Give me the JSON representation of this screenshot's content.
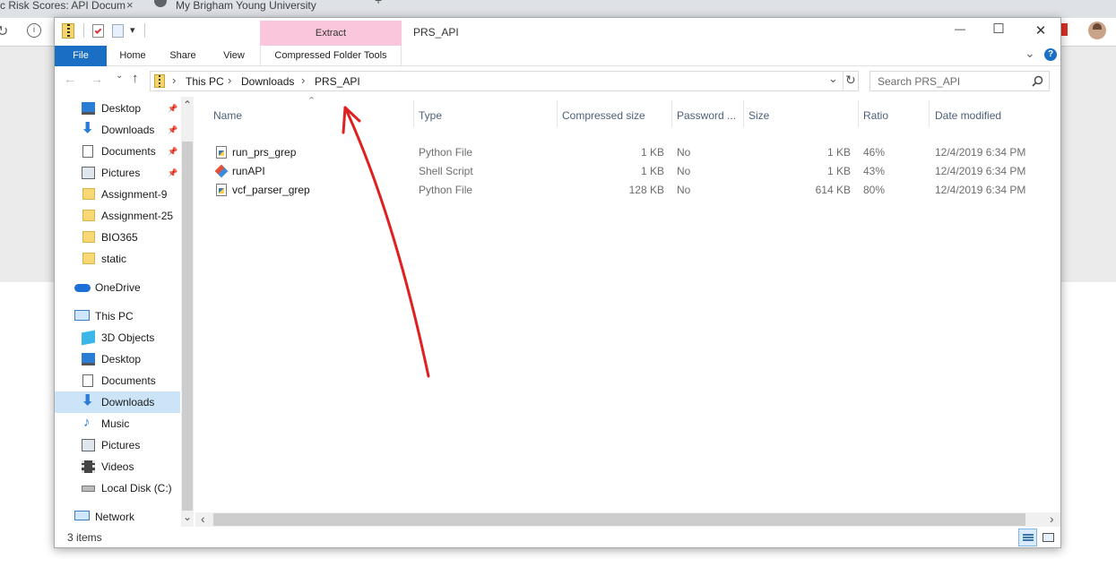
{
  "browser": {
    "tabs": [
      "c Risk Scores: API Docum",
      "My Brigham Young University Ho"
    ],
    "close_glyph": "×",
    "new_tab_glyph": "+"
  },
  "window": {
    "title": "PRS_API",
    "qat_dropdown": "▾",
    "minimize": "—",
    "maximize": "☐",
    "close": "✕"
  },
  "ribbon": {
    "contextual_group": "Extract",
    "tabs": {
      "file": "File",
      "home": "Home",
      "share": "Share",
      "view": "View",
      "compressed": "Compressed Folder Tools"
    },
    "expand_glyph": "⌄",
    "help_glyph": "?"
  },
  "address": {
    "sep": "›",
    "path": [
      "This PC",
      "Downloads",
      "PRS_API"
    ],
    "dropdown": "⌄",
    "refresh": "↻",
    "search_placeholder": "Search PRS_API",
    "back": "←",
    "forward": "→",
    "up": "↑"
  },
  "nav": {
    "quick_access": [
      {
        "label": "Desktop",
        "pinned": true
      },
      {
        "label": "Downloads",
        "pinned": true
      },
      {
        "label": "Documents",
        "pinned": true
      },
      {
        "label": "Pictures",
        "pinned": true
      },
      {
        "label": "Assignment-9",
        "pinned": false
      },
      {
        "label": "Assignment-25",
        "pinned": false
      },
      {
        "label": "BIO365",
        "pinned": false
      },
      {
        "label": "static",
        "pinned": false
      }
    ],
    "onedrive": "OneDrive",
    "this_pc": "This PC",
    "this_pc_items": [
      "3D Objects",
      "Desktop",
      "Documents",
      "Downloads",
      "Music",
      "Pictures",
      "Videos",
      "Local Disk (C:)"
    ],
    "network": "Network",
    "scroll_up": "⌃",
    "scroll_down": "⌄",
    "pin_glyph": "📌"
  },
  "columns": {
    "name": "Name",
    "type": "Type",
    "compressed_size": "Compressed size",
    "password": "Password ...",
    "size": "Size",
    "ratio": "Ratio",
    "date_modified": "Date modified",
    "sort_glyph": "⌃"
  },
  "files": [
    {
      "name": "run_prs_grep",
      "type": "Python File",
      "compressed_size": "1 KB",
      "password": "No",
      "size": "1 KB",
      "ratio": "46%",
      "date_modified": "12/4/2019 6:34 PM",
      "icon": "python-file-icon"
    },
    {
      "name": "runAPI",
      "type": "Shell Script",
      "compressed_size": "1 KB",
      "password": "No",
      "size": "1 KB",
      "ratio": "43%",
      "date_modified": "12/4/2019 6:34 PM",
      "icon": "shell-script-icon"
    },
    {
      "name": "vcf_parser_grep",
      "type": "Python File",
      "compressed_size": "128 KB",
      "password": "No",
      "size": "614 KB",
      "ratio": "80%",
      "date_modified": "12/4/2019 6:34 PM",
      "icon": "python-file-icon"
    }
  ],
  "hscroll": {
    "left": "‹",
    "right": "›"
  },
  "status": {
    "items": "3 items"
  },
  "colors": {
    "accent": "#1a6fc4",
    "contextual_tab": "#f9c6dc",
    "annotation": "#e02020",
    "selected_nav": "#cce4f7"
  }
}
